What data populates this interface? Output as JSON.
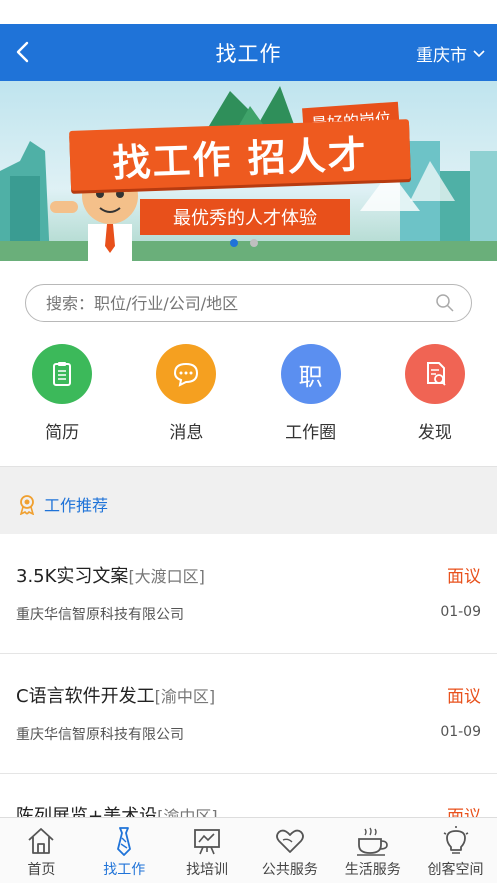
{
  "header": {
    "title": "找工作",
    "city": "重庆市"
  },
  "banner": {
    "tag": "最好的岗位",
    "headline": "找工作 招人才",
    "subline": "最优秀的人才体验"
  },
  "search": {
    "placeholder": "搜索：职位/行业/公司/地区"
  },
  "shortcuts": [
    {
      "label": "简历",
      "color": "#3cb95a",
      "icon": "resume-icon"
    },
    {
      "label": "消息",
      "color": "#f5a020",
      "icon": "chat-icon"
    },
    {
      "label": "工作圈",
      "color": "#5b8ff0",
      "icon": "work-circle-icon",
      "glyph": "职"
    },
    {
      "label": "发现",
      "color": "#f06454",
      "icon": "discover-icon"
    }
  ],
  "recommend": {
    "title": "工作推荐"
  },
  "jobs": [
    {
      "title": "3.5K实习文案",
      "area": "[大渡口区]",
      "salary": "面议",
      "company": "重庆华信智原科技有限公司",
      "date": "01-09"
    },
    {
      "title": "C语言软件开发工",
      "area": "[渝中区]",
      "salary": "面议",
      "company": "重庆华信智原科技有限公司",
      "date": "01-09"
    },
    {
      "title": "陈列展览+美术设",
      "area": "[渝中区]",
      "salary": "面议",
      "company": "",
      "date": ""
    }
  ],
  "tabbar": [
    {
      "label": "首页",
      "icon": "home-icon"
    },
    {
      "label": "找工作",
      "icon": "tie-icon",
      "active": true
    },
    {
      "label": "找培训",
      "icon": "training-board-icon"
    },
    {
      "label": "公共服务",
      "icon": "heart-hands-icon"
    },
    {
      "label": "生活服务",
      "icon": "coffee-cup-icon"
    },
    {
      "label": "创客空间",
      "icon": "lightbulb-icon"
    }
  ],
  "colors": {
    "primary": "#1f73d8",
    "accent": "#e8501b"
  }
}
